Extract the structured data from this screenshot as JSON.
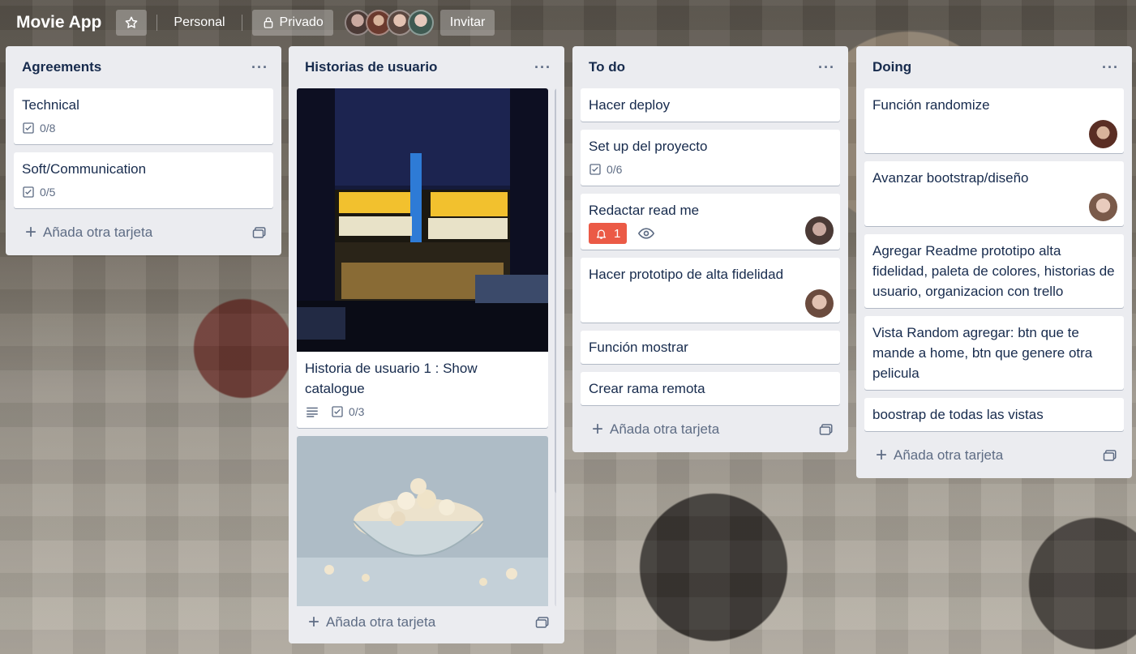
{
  "board": {
    "title": "Movie App",
    "workspace": "Personal",
    "visibility": "Privado",
    "invite_label": "Invitar"
  },
  "lists": [
    {
      "title": "Agreements",
      "cards": [
        {
          "title": "Technical",
          "checklist": "0/8"
        },
        {
          "title": "Soft/Communication",
          "checklist": "0/5"
        }
      ],
      "add_label": "Añada otra tarjeta"
    },
    {
      "title": "Historias de usuario",
      "cards": [
        {
          "title": "Historia de usuario 1 : Show catalogue",
          "checklist": "0/3"
        }
      ],
      "add_label": "Añada otra tarjeta"
    },
    {
      "title": "To do",
      "cards": [
        {
          "title": "Hacer deploy"
        },
        {
          "title": "Set up del proyecto",
          "checklist": "0/6"
        },
        {
          "title": "Redactar read me",
          "notifications": "1"
        },
        {
          "title": "Hacer prototipo de alta fidelidad"
        },
        {
          "title": "Función mostrar"
        },
        {
          "title": "Crear rama remota"
        }
      ],
      "add_label": "Añada otra tarjeta"
    },
    {
      "title": "Doing",
      "cards": [
        {
          "title": "Función randomize"
        },
        {
          "title": "Avanzar bootstrap/diseño"
        },
        {
          "title": "Agregar Readme prototipo alta fidelidad, paleta de colores, historias de usuario, organizacion con trello"
        },
        {
          "title": "Vista Random agregar: btn que te mande a home, btn que genere otra pelicula"
        },
        {
          "title": "boostrap de todas las vistas"
        }
      ],
      "add_label": "Añada otra tarjeta"
    }
  ],
  "colors": {
    "list_bg": "#ebecf0",
    "notification": "#eb5a46",
    "text": "#172b4d",
    "muted": "#5e6c84"
  }
}
